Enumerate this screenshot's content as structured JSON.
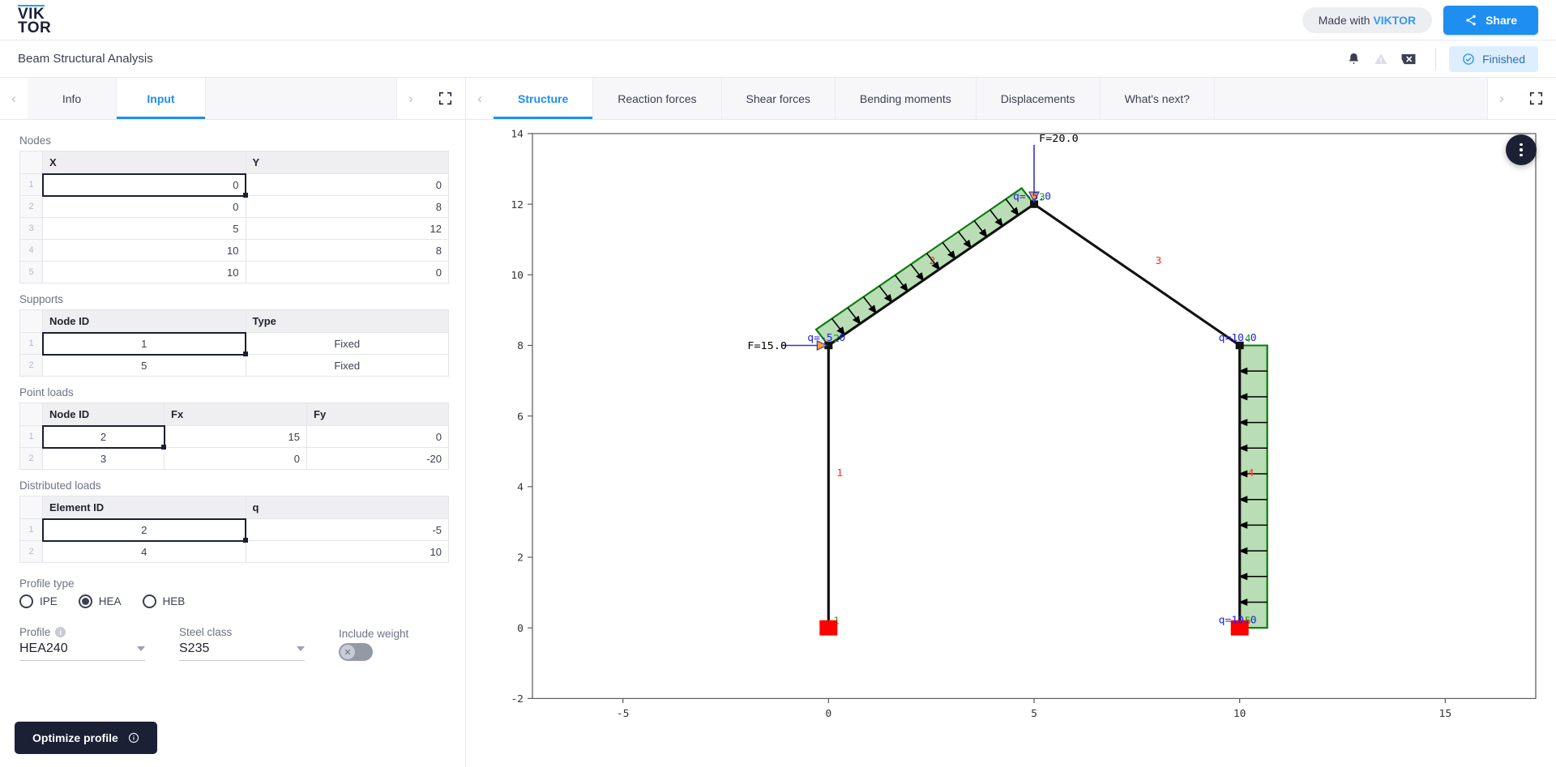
{
  "brand": {
    "line1": "VIK",
    "line2": "TOR"
  },
  "topbar": {
    "made_with_prefix": "Made with ",
    "made_with_brand": "VIKTOR",
    "share_label": "Share",
    "share_icon": "share-icon",
    "accent_color": "#1f8ef1"
  },
  "subbar": {
    "app_title": "Beam Structural Analysis",
    "bell_icon": "bell-icon",
    "warning_icon": "warning-triangle-icon",
    "close_icon": "close-badge-icon",
    "status_label": "Finished",
    "status_icon": "check-circle-icon",
    "status_color": "#ddeeff"
  },
  "left_tabs": {
    "prev_icon": "chevron-left-icon",
    "next_icon": "chevron-right-icon",
    "expand_icon": "fullscreen-icon",
    "items": [
      {
        "label": "Info",
        "active": false
      },
      {
        "label": "Input",
        "active": true
      }
    ]
  },
  "right_tabs": {
    "prev_icon": "chevron-left-icon",
    "next_icon": "chevron-right-icon",
    "expand_icon": "fullscreen-icon",
    "items": [
      {
        "label": "Structure",
        "active": true
      },
      {
        "label": "Reaction forces",
        "active": false
      },
      {
        "label": "Shear forces",
        "active": false
      },
      {
        "label": "Bending moments",
        "active": false
      },
      {
        "label": "Displacements",
        "active": false
      },
      {
        "label": "What's next?",
        "active": false
      }
    ]
  },
  "form": {
    "nodes": {
      "title": "Nodes",
      "columns": [
        "X",
        "Y"
      ],
      "rows": [
        {
          "n": "1",
          "X": "0",
          "Y": "0"
        },
        {
          "n": "2",
          "X": "0",
          "Y": "8"
        },
        {
          "n": "3",
          "X": "5",
          "Y": "12"
        },
        {
          "n": "4",
          "X": "10",
          "Y": "8"
        },
        {
          "n": "5",
          "X": "10",
          "Y": "0"
        }
      ]
    },
    "supports": {
      "title": "Supports",
      "columns": [
        "Node ID",
        "Type"
      ],
      "rows": [
        {
          "n": "1",
          "node_id": "1",
          "type": "Fixed"
        },
        {
          "n": "2",
          "node_id": "5",
          "type": "Fixed"
        }
      ]
    },
    "point_loads": {
      "title": "Point loads",
      "columns": [
        "Node ID",
        "Fx",
        "Fy"
      ],
      "rows": [
        {
          "n": "1",
          "node_id": "2",
          "fx": "15",
          "fy": "0"
        },
        {
          "n": "2",
          "node_id": "3",
          "fx": "0",
          "fy": "-20"
        }
      ]
    },
    "distributed_loads": {
      "title": "Distributed loads",
      "columns": [
        "Element ID",
        "q"
      ],
      "rows": [
        {
          "n": "1",
          "element_id": "2",
          "q": "-5"
        },
        {
          "n": "2",
          "element_id": "4",
          "q": "10"
        }
      ]
    },
    "profile_type": {
      "title": "Profile type",
      "options": [
        {
          "label": "IPE",
          "selected": false
        },
        {
          "label": "HEA",
          "selected": true
        },
        {
          "label": "HEB",
          "selected": false
        }
      ]
    },
    "profile": {
      "caption": "Profile",
      "value": "HEA240",
      "info_icon": "info-icon",
      "caret_icon": "chevron-down-icon"
    },
    "steel_class": {
      "caption": "Steel class",
      "value": "S235",
      "caret_icon": "chevron-down-icon"
    },
    "include_weight": {
      "caption": "Include weight",
      "on": false,
      "knob_icon": "cross-icon"
    },
    "optimize": {
      "label": "Optimize profile",
      "info_icon": "info-circle-icon"
    }
  },
  "plot_menu": {
    "icon": "kebab-menu-icon"
  },
  "chart_data": {
    "type": "diagram",
    "title": "Structure",
    "xlabel": "",
    "ylabel": "",
    "xlim": [
      -7.2,
      17.2
    ],
    "ylim": [
      -2,
      14
    ],
    "xticks": [
      "-5",
      "0",
      "5",
      "10",
      "15"
    ],
    "xtick_values": [
      -5,
      0,
      5,
      10,
      15
    ],
    "yticks": [
      "-2",
      "0",
      "2",
      "4",
      "6",
      "8",
      "10",
      "12",
      "14"
    ],
    "ytick_values": [
      -2,
      0,
      2,
      4,
      6,
      8,
      10,
      12,
      14
    ],
    "grid": false,
    "nodes": [
      {
        "id": "1",
        "x": 0,
        "y": 0
      },
      {
        "id": "2",
        "x": 0,
        "y": 8
      },
      {
        "id": "3",
        "x": 5,
        "y": 12
      },
      {
        "id": "4",
        "x": 10,
        "y": 8
      },
      {
        "id": "5",
        "x": 10,
        "y": 0
      }
    ],
    "elements": [
      {
        "id": "1",
        "from": 1,
        "to": 2,
        "label_x": 0.0,
        "label_y": 4.3
      },
      {
        "id": "2",
        "from": 2,
        "to": 3,
        "label_x": 2.25,
        "label_y": 10.3
      },
      {
        "id": "3",
        "from": 3,
        "to": 4,
        "label_x": 7.75,
        "label_y": 10.3
      },
      {
        "id": "4",
        "from": 4,
        "to": 5,
        "label_x": 10.0,
        "label_y": 4.3
      }
    ],
    "supports": [
      {
        "node": "1",
        "x": 0,
        "y": 0,
        "type": "Fixed"
      },
      {
        "node": "5",
        "x": 10,
        "y": 0,
        "type": "Fixed"
      }
    ],
    "point_loads": [
      {
        "node": "2",
        "x": 0,
        "y": 8,
        "label": "F=15.0",
        "dir": "x",
        "value": 15.0
      },
      {
        "node": "3",
        "x": 5,
        "y": 12,
        "label": "F=20.0",
        "dir": "y",
        "value": -20.0
      }
    ],
    "distributed_loads": [
      {
        "element": "2",
        "label": "q=-5.0",
        "value": -5.0,
        "start_label_x": 0,
        "start_label_y": 8,
        "end_label_x": 5,
        "end_label_y": 12
      },
      {
        "element": "4",
        "label": "q=10.0",
        "value": 10.0,
        "start_label_x": 10,
        "start_label_y": 8,
        "end_label_x": 10,
        "end_label_y": 0
      }
    ],
    "colors": {
      "element": "#111111",
      "element_label": "#ff2b2b",
      "node_label": "#11a011",
      "load_label": "#2222dd",
      "load_arrow": "#3333cc",
      "support": "#ff0000",
      "distributed_fill": "#b9ddb4",
      "distributed_edge": "#0a7a0a"
    }
  }
}
